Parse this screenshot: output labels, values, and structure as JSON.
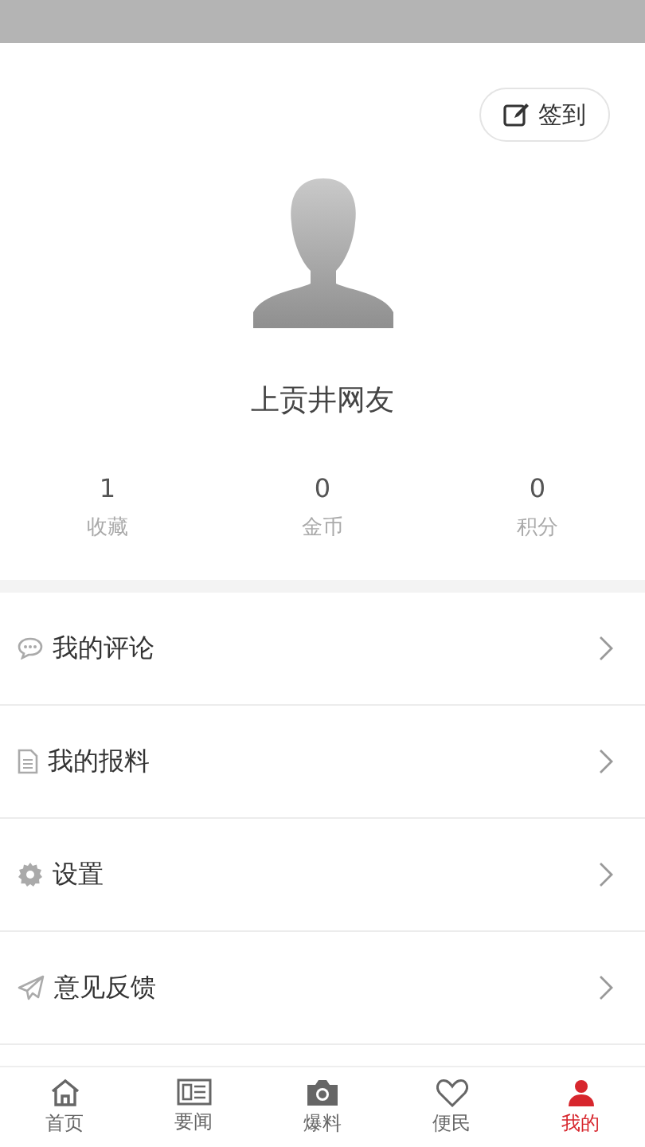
{
  "checkin": {
    "label": "签到"
  },
  "profile": {
    "username": "上贡井网友"
  },
  "stats": [
    {
      "value": "1",
      "label": "收藏"
    },
    {
      "value": "0",
      "label": "金币"
    },
    {
      "value": "0",
      "label": "积分"
    }
  ],
  "menu": [
    {
      "kind": "comment",
      "label": "我的评论"
    },
    {
      "kind": "report",
      "label": "我的报料"
    },
    {
      "kind": "settings",
      "label": "设置"
    },
    {
      "kind": "feedback",
      "label": "意见反馈"
    }
  ],
  "tabs": [
    {
      "kind": "home",
      "label": "首页",
      "selected": false
    },
    {
      "kind": "news",
      "label": "要闻",
      "selected": false
    },
    {
      "kind": "camera",
      "label": "爆料",
      "selected": false
    },
    {
      "kind": "service",
      "label": "便民",
      "selected": false
    },
    {
      "kind": "me",
      "label": "我的",
      "selected": true
    }
  ]
}
